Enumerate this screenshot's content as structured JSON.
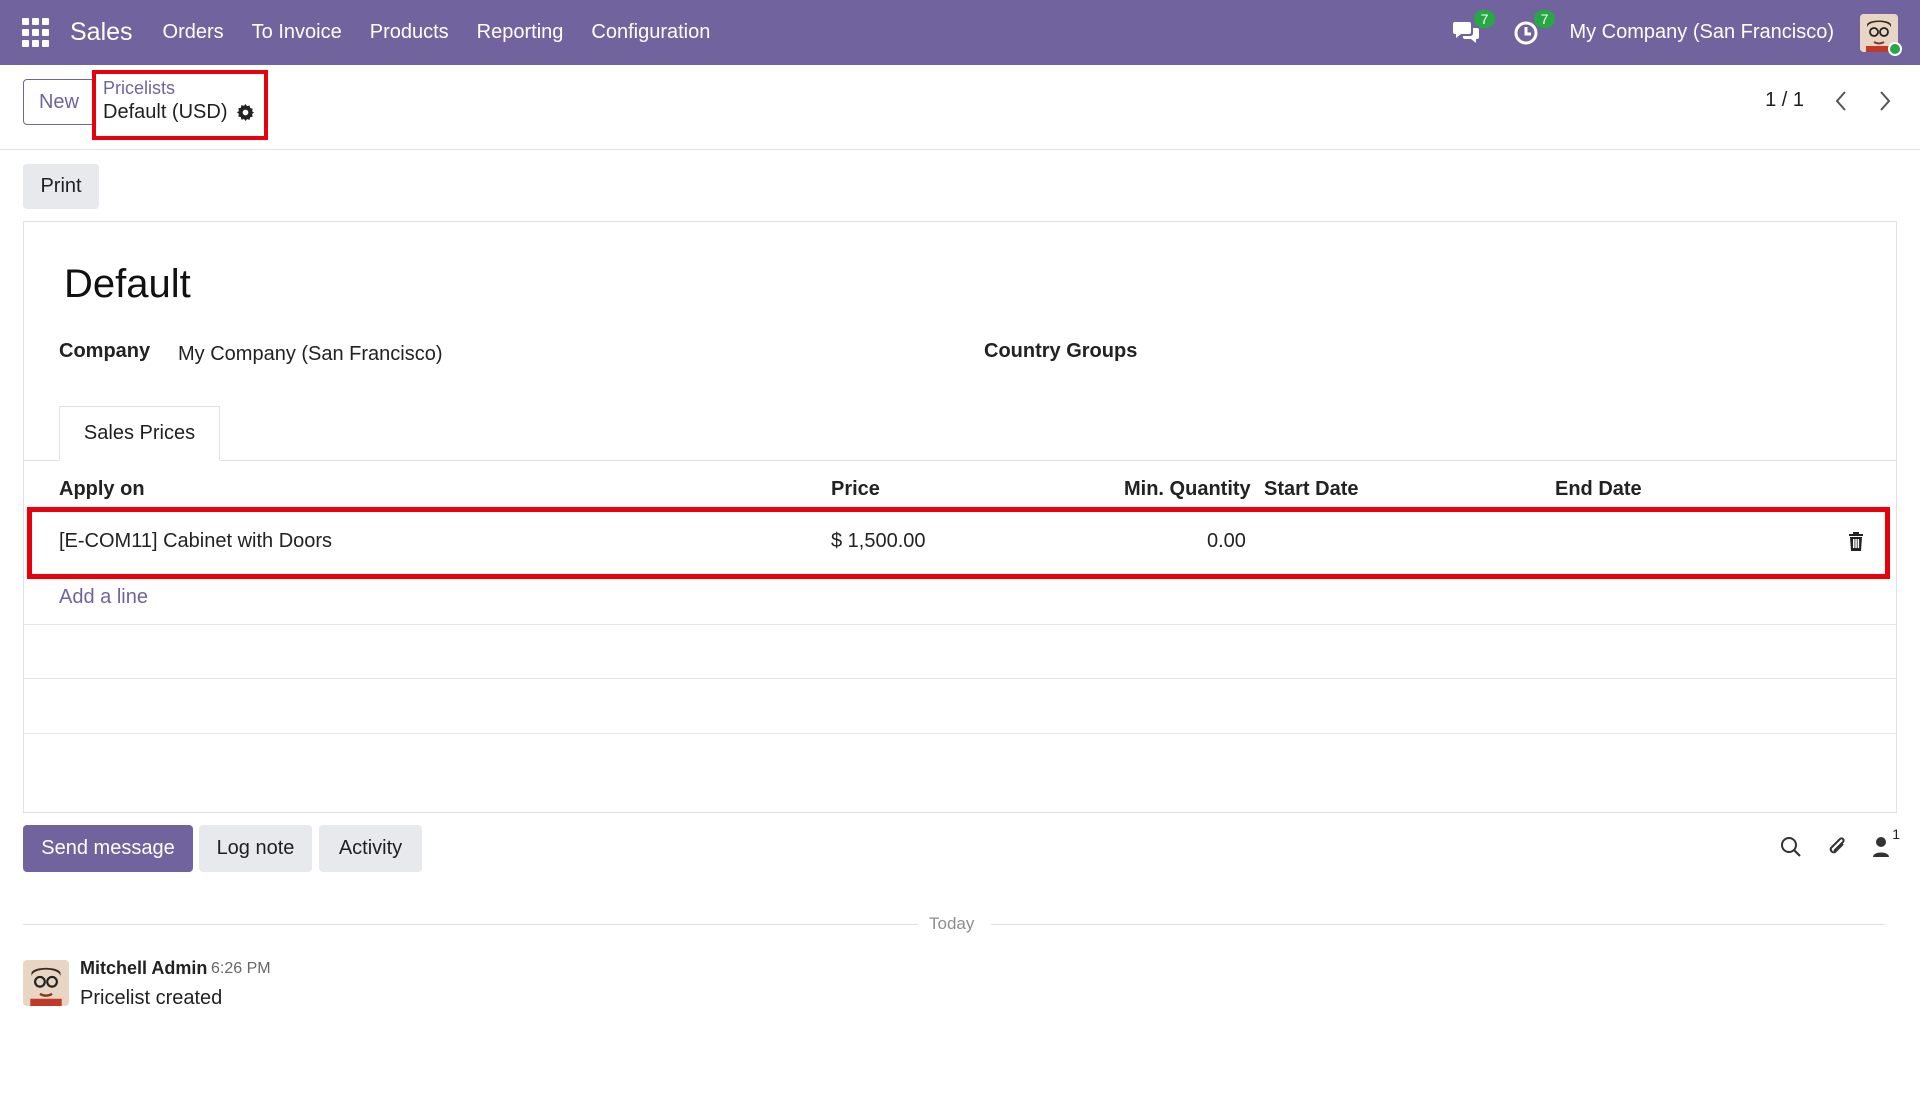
{
  "navbar": {
    "app_name": "Sales",
    "menu": [
      "Orders",
      "To Invoice",
      "Products",
      "Reporting",
      "Configuration"
    ],
    "messages_count": "7",
    "activities_count": "7",
    "company": "My Company (San Francisco)",
    "color": "#71639e"
  },
  "control_panel": {
    "new_label": "New",
    "breadcrumb_parent": "Pricelists",
    "breadcrumb_current": "Default (USD)",
    "pager_value": "1 / 1"
  },
  "actions": {
    "print_label": "Print"
  },
  "form": {
    "title": "Default",
    "company_label": "Company",
    "company_value": "My Company (San Francisco)",
    "country_groups_label": "Country Groups",
    "tab_label": "Sales Prices",
    "columns": [
      "Apply on",
      "Price",
      "Min. Quantity",
      "Start Date",
      "End Date"
    ],
    "rows": [
      {
        "apply_on": "[E-COM11] Cabinet with Doors",
        "price": "$ 1,500.00",
        "min_quantity": "0.00",
        "start_date": "",
        "end_date": ""
      }
    ],
    "add_line_label": "Add a line"
  },
  "chatter": {
    "send_message_label": "Send message",
    "log_note_label": "Log note",
    "activity_label": "Activity",
    "followers_count": "1",
    "date_separator": "Today",
    "messages": [
      {
        "author": "Mitchell Admin",
        "time": "6:26 PM",
        "body": "Pricelist created"
      }
    ]
  }
}
